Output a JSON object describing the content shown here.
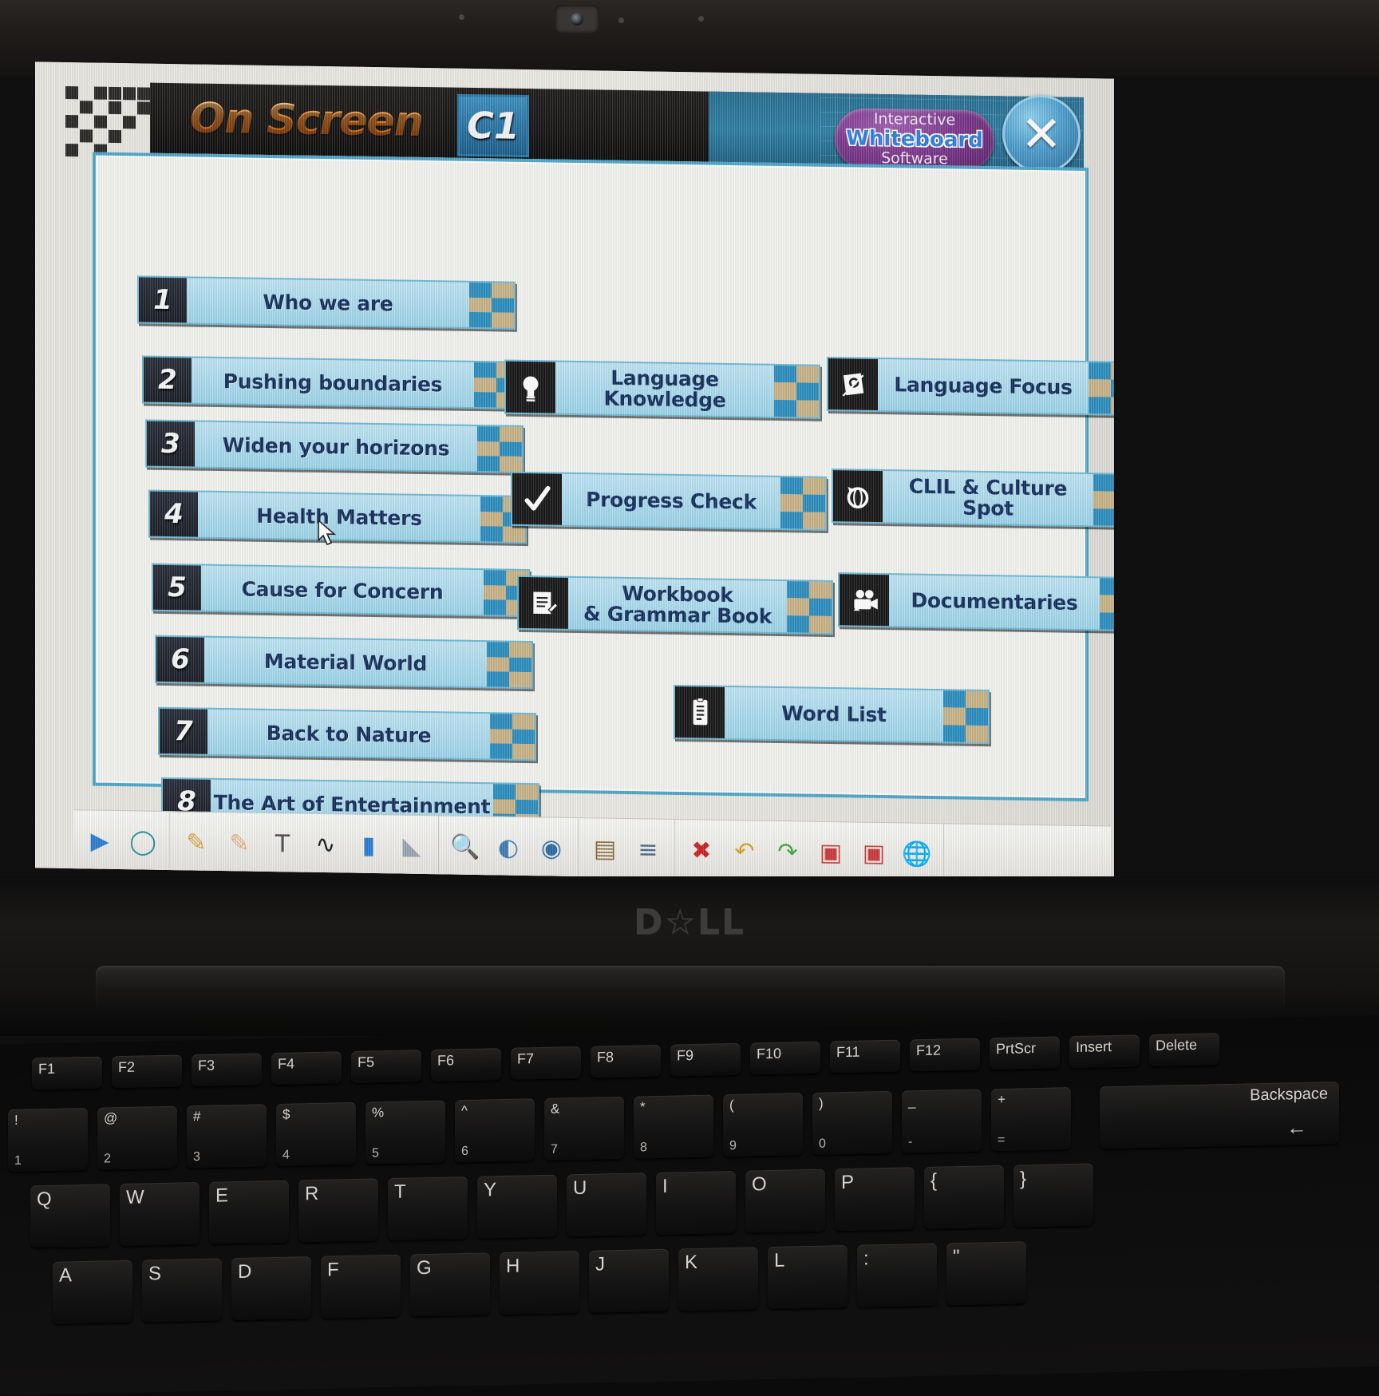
{
  "app": {
    "brand_title": "On Screen",
    "level_badge": "C1",
    "logo": {
      "line1": "Interactive",
      "line2": "Whiteboard",
      "line3": "Software"
    },
    "close_label": "✕",
    "close_icon": "close-icon"
  },
  "colors": {
    "accent_blue": "#2f8fc0",
    "panel_light_blue": "#9ed5ea",
    "label_navy": "#17305e",
    "checker_tan": "#c9b489",
    "header_dark": "#181716",
    "logo_purple": "#7d3a8e",
    "brand_orange": "#e8832a"
  },
  "units": [
    {
      "number": "1",
      "label": "Who we are"
    },
    {
      "number": "2",
      "label": "Pushing boundaries"
    },
    {
      "number": "3",
      "label": "Widen your horizons"
    },
    {
      "number": "4",
      "label": "Health Matters"
    },
    {
      "number": "5",
      "label": "Cause for Concern"
    },
    {
      "number": "6",
      "label": "Material World"
    },
    {
      "number": "7",
      "label": "Back to Nature"
    },
    {
      "number": "8",
      "label": "The Art of Entertainment"
    }
  ],
  "sections": [
    {
      "label": "Language Knowledge",
      "icon": "lightbulb-icon"
    },
    {
      "label": "Language Focus",
      "icon": "book-magnifier-icon"
    },
    {
      "label": "Progress Check",
      "icon": "checkmark-icon"
    },
    {
      "label": "CLIL & Culture Spot",
      "icon": "globe-arrow-icon"
    },
    {
      "label": "Workbook\n& Grammar Book",
      "line1": "Workbook",
      "line2": "& Grammar Book",
      "icon": "notepad-pencil-icon"
    },
    {
      "label": "Documentaries",
      "icon": "film-camera-icon"
    },
    {
      "label": "Word List",
      "icon": "document-list-icon"
    }
  ],
  "toolbar": {
    "tools": [
      {
        "name": "select-arrow-icon",
        "glyph": "▶"
      },
      {
        "name": "lasso-icon",
        "glyph": "◯"
      },
      {
        "name": "pen-thin-icon",
        "glyph": "✎"
      },
      {
        "name": "pen-thick-icon",
        "glyph": "✎"
      },
      {
        "name": "text-tool-icon",
        "glyph": "T"
      },
      {
        "name": "freehand-line-icon",
        "glyph": "∿"
      },
      {
        "name": "highlighter-icon",
        "glyph": "▮"
      },
      {
        "name": "eraser-icon",
        "glyph": "◣"
      },
      {
        "name": "zoom-magnifier-icon",
        "glyph": "🔍"
      },
      {
        "name": "screen-shade-icon",
        "glyph": "◐"
      },
      {
        "name": "spotlight-eye-icon",
        "glyph": "◉"
      },
      {
        "name": "notes-page-icon",
        "glyph": "▤"
      },
      {
        "name": "align-icon",
        "glyph": "≡"
      },
      {
        "name": "delete-icon",
        "glyph": "✖"
      },
      {
        "name": "undo-icon",
        "glyph": "↶"
      },
      {
        "name": "redo-icon",
        "glyph": "↷"
      },
      {
        "name": "save-icon",
        "glyph": "▣"
      },
      {
        "name": "save-as-icon",
        "glyph": "▣"
      },
      {
        "name": "internet-globe-icon",
        "glyph": "🌐"
      }
    ]
  },
  "hardware": {
    "laptop_brand": "D☆LL",
    "function_keys": [
      "F1",
      "F2",
      "F3",
      "F4",
      "F5",
      "F6",
      "F7",
      "F8",
      "F9",
      "F10",
      "F11",
      "F12",
      "PrtScr",
      "Insert",
      "Delete"
    ],
    "number_row": [
      {
        "shift": "!",
        "main": "1"
      },
      {
        "shift": "@",
        "main": "2"
      },
      {
        "shift": "#",
        "main": "3"
      },
      {
        "shift": "$",
        "main": "4"
      },
      {
        "shift": "%",
        "main": "5"
      },
      {
        "shift": "^",
        "main": "6"
      },
      {
        "shift": "&",
        "main": "7"
      },
      {
        "shift": "*",
        "main": "8"
      },
      {
        "shift": "(",
        "main": "9"
      },
      {
        "shift": ")",
        "main": "0"
      },
      {
        "shift": "_",
        "main": "-"
      },
      {
        "shift": "+",
        "main": "="
      }
    ],
    "backspace_label": "Backspace",
    "qwerty_row": [
      "Q",
      "W",
      "E",
      "R",
      "T",
      "Y",
      "U",
      "I",
      "O",
      "P",
      "{",
      "}"
    ],
    "asdf_row": [
      "A",
      "S",
      "D",
      "F",
      "G",
      "H",
      "J",
      "K",
      "L",
      ":",
      "\""
    ]
  }
}
